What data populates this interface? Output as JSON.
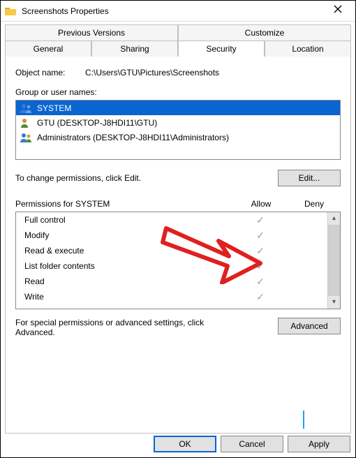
{
  "window": {
    "title": "Screenshots Properties"
  },
  "tabs": {
    "row1": [
      "Previous Versions",
      "Customize"
    ],
    "row2": [
      "General",
      "Sharing",
      "Security",
      "Location"
    ],
    "active": "Security"
  },
  "object": {
    "label": "Object name:",
    "value": "C:\\Users\\GTU\\Pictures\\Screenshots"
  },
  "group": {
    "label": "Group or user names:",
    "items": [
      {
        "name": "SYSTEM",
        "selected": true,
        "icon": "group-icon"
      },
      {
        "name": "GTU (DESKTOP-J8HDI11\\GTU)",
        "selected": false,
        "icon": "user-icon"
      },
      {
        "name": "Administrators (DESKTOP-J8HDI11\\Administrators)",
        "selected": false,
        "icon": "group-icon"
      }
    ]
  },
  "editRow": {
    "hint": "To change permissions, click Edit.",
    "button": "Edit..."
  },
  "perm": {
    "header": "Permissions for SYSTEM",
    "allow": "Allow",
    "deny": "Deny",
    "rows": [
      {
        "name": "Full control",
        "allow": true,
        "deny": false
      },
      {
        "name": "Modify",
        "allow": true,
        "deny": false
      },
      {
        "name": "Read & execute",
        "allow": true,
        "deny": false
      },
      {
        "name": "List folder contents",
        "allow": true,
        "deny": false
      },
      {
        "name": "Read",
        "allow": true,
        "deny": false
      },
      {
        "name": "Write",
        "allow": true,
        "deny": false
      }
    ]
  },
  "advanced": {
    "text": "For special permissions or advanced settings, click Advanced.",
    "button": "Advanced"
  },
  "buttons": {
    "ok": "OK",
    "cancel": "Cancel",
    "apply": "Apply"
  }
}
